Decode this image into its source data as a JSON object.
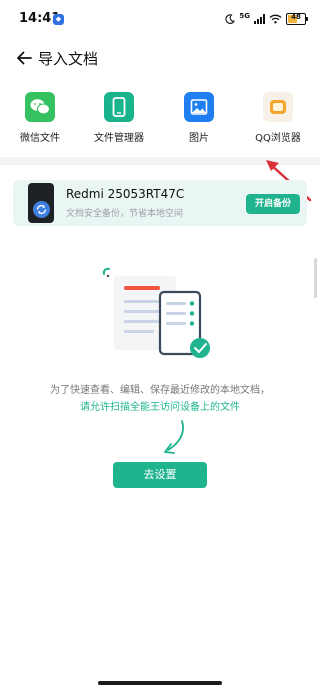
{
  "status": {
    "time": "14:41",
    "network": "5G",
    "battery": "48"
  },
  "header": {
    "title": "导入文档"
  },
  "sources": [
    {
      "label": "微信文件",
      "icon": "wechat-icon"
    },
    {
      "label": "文件管理器",
      "icon": "phone-files-icon"
    },
    {
      "label": "图片",
      "icon": "image-icon"
    },
    {
      "label": "QQ浏览器",
      "icon": "qq-browser-icon"
    }
  ],
  "backup": {
    "device_name": "Redmi 25053RT47C",
    "subtitle": "文档安全备份，节省本地空间",
    "button": "开启备份"
  },
  "permission": {
    "message": "为了快速查看、编辑、保存最近修改的本地文档，",
    "highlight": "请允许扫描全能王访问设备上的文件",
    "button": "去设置"
  },
  "colors": {
    "accent": "#1fb48e",
    "annotation_arrow": "#d9323a"
  }
}
